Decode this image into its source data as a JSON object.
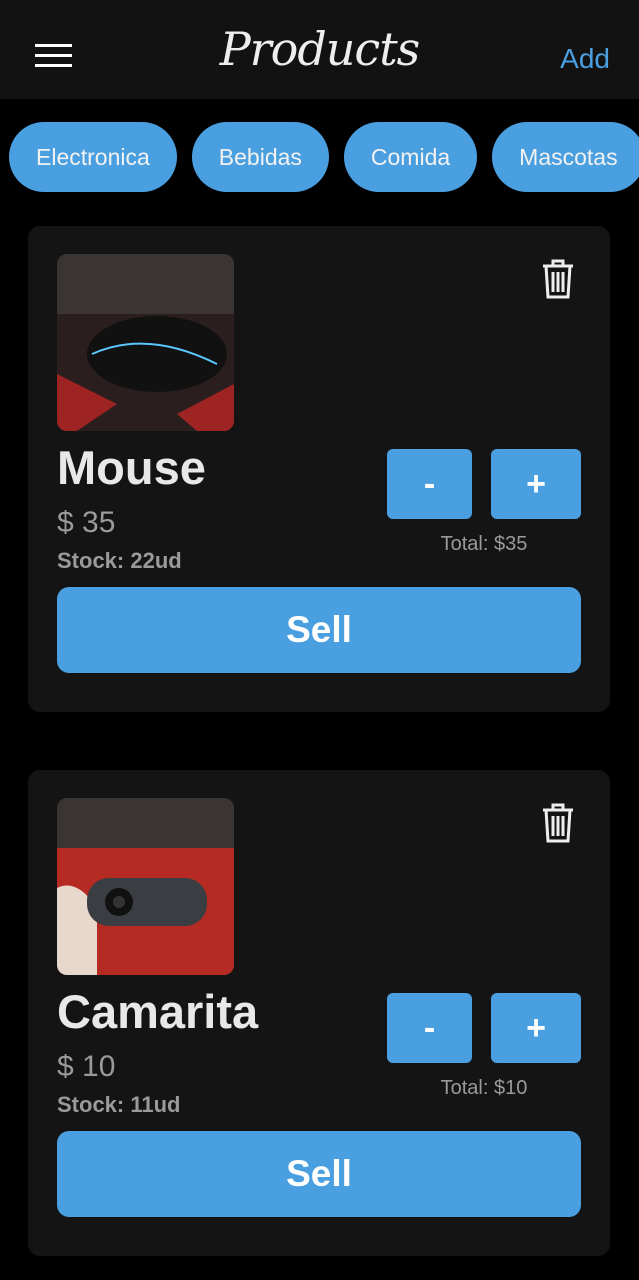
{
  "header": {
    "title": "Products",
    "add_label": "Add",
    "menu_icon": "hamburger-icon"
  },
  "categories": [
    "Electronica",
    "Bebidas",
    "Comida",
    "Mascotas"
  ],
  "colors": {
    "accent": "#4a9fe0",
    "card": "#141414",
    "header": "#121212"
  },
  "products": [
    {
      "name": "Mouse",
      "price": "$ 35",
      "stock": "Stock: 22ud",
      "minus": "-",
      "plus": "+",
      "total": "Total: $35",
      "sell": "Sell"
    },
    {
      "name": "Camarita",
      "price": "$ 10",
      "stock": "Stock: 11ud",
      "minus": "-",
      "plus": "+",
      "total": "Total: $10",
      "sell": "Sell"
    }
  ]
}
